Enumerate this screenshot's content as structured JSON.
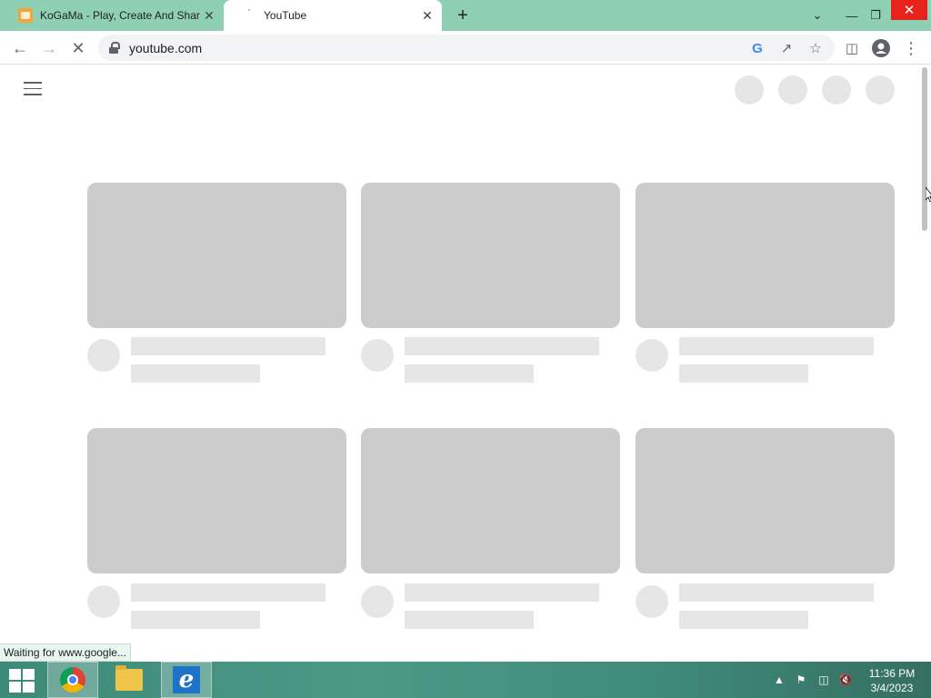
{
  "browser": {
    "tabs": [
      {
        "title": "KoGaMa - Play, Create And Share",
        "active": false
      },
      {
        "title": "YouTube",
        "active": true
      }
    ],
    "new_tab_label": "+",
    "close_glyph": "✕",
    "url": "youtube.com",
    "status_text": "Waiting for www.google..."
  },
  "taskbar": {
    "apps": [
      "chrome-icon",
      "file-explorer-icon",
      "internet-explorer-icon"
    ],
    "clock_time": "11:36 PM",
    "clock_date": "3/4/2023"
  },
  "colors": {
    "tabstrip": "#8fd0b5",
    "skeleton_thumb": "#cccccc",
    "skeleton_line": "#e6e6e6",
    "close_red": "#e8231b"
  }
}
